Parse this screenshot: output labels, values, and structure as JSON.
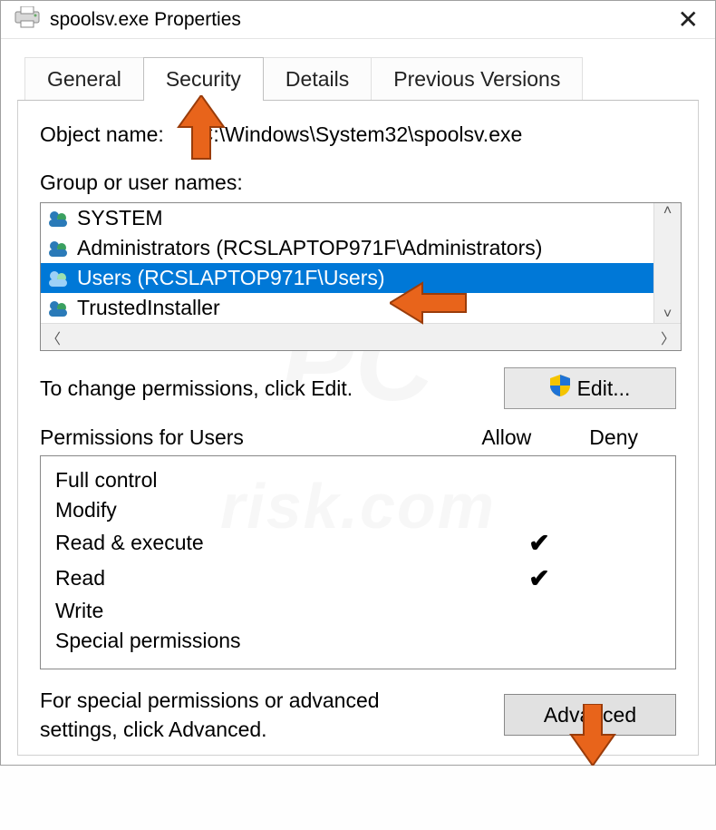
{
  "title": "spoolsv.exe Properties",
  "tabs": {
    "general": "General",
    "security": "Security",
    "details": "Details",
    "previous": "Previous Versions"
  },
  "object_name_label": "Object name:",
  "object_name_value": "C:\\Windows\\System32\\spoolsv.exe",
  "group_label": "Group or user names:",
  "principals": {
    "p0": "SYSTEM",
    "p1": "Administrators (RCSLAPTOP971F\\Administrators)",
    "p2": "Users (RCSLAPTOP971F\\Users)",
    "p3": "TrustedInstaller"
  },
  "selected_principal": "Users",
  "change_permissions_text": "To change permissions, click Edit.",
  "edit_button": "Edit...",
  "permissions_for_label": "Permissions for Users",
  "allow_label": "Allow",
  "deny_label": "Deny",
  "perm_rows": {
    "full_control": {
      "name": "Full control",
      "allow": "",
      "deny": ""
    },
    "modify": {
      "name": "Modify",
      "allow": "",
      "deny": ""
    },
    "read_execute": {
      "name": "Read & execute",
      "allow": "✔",
      "deny": ""
    },
    "read": {
      "name": "Read",
      "allow": "✔",
      "deny": ""
    },
    "write": {
      "name": "Write",
      "allow": "",
      "deny": ""
    },
    "special": {
      "name": "Special permissions",
      "allow": "",
      "deny": ""
    }
  },
  "advanced_text": "For special permissions or advanced settings, click Advanced.",
  "advanced_button": "Advanced",
  "watermark1": "PC",
  "watermark2": "risk.com"
}
